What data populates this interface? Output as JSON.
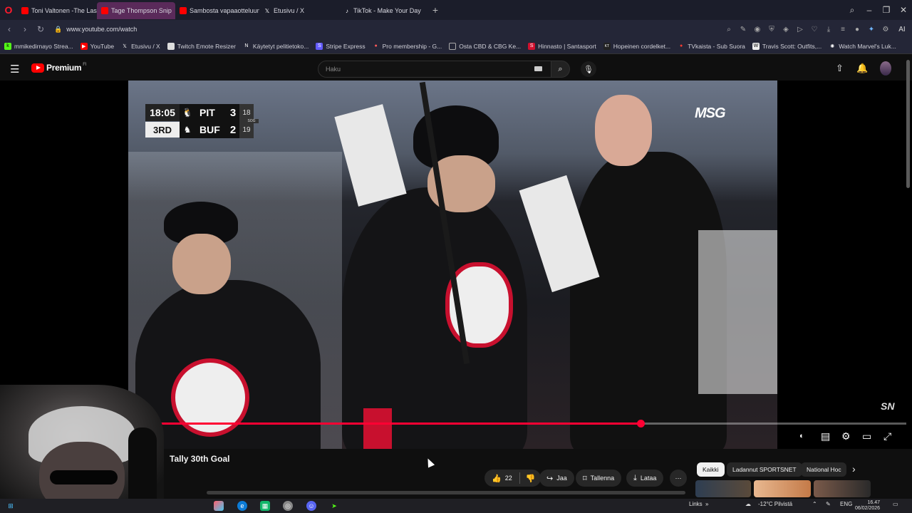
{
  "browser": {
    "tabs": [
      {
        "label": "Toni Valtonen -The Last D",
        "state": "normal"
      },
      {
        "label": "Tage Thompson Snip",
        "state": "active"
      },
      {
        "label": "Sambosta vapaaotteluun",
        "state": "normal"
      },
      {
        "label": "Etusivu / X",
        "state": "normal"
      },
      {
        "label": "TikTok - Make Your Day",
        "state": "normal"
      }
    ],
    "url": "www.youtube.com/watch",
    "ai_label": "AI",
    "bookmarks": [
      "mmikedirnayo Strea...",
      "YouTube",
      "Etusivu / X",
      "Twitch Emote Resizer",
      "Käytetyt pelitietoko...",
      "Stripe Express",
      "Pro membership - G...",
      "Osta CBD & CBG Ke...",
      "Hinnasto | Santasport",
      "Hopeinen cordelket...",
      "TVkaista - Sub Suora",
      "Travis Scott: Outfits,...",
      "Watch Marvel's Luk..."
    ]
  },
  "youtube": {
    "logo_text": "Premium",
    "logo_region": "FI",
    "search_placeholder": "Haku"
  },
  "video": {
    "scorebug": {
      "clock": "18:05",
      "period": "3RD",
      "away": {
        "team": "PIT",
        "score": "3",
        "sog": "18"
      },
      "home": {
        "team": "BUF",
        "score": "2",
        "sog": "19"
      },
      "sog_label": "SOG"
    },
    "network_logo": "MSG",
    "corner_logo": "SN",
    "progress": 0.705,
    "title": "Tally 30th Goal"
  },
  "actions": {
    "likes": "22",
    "share": "Jaa",
    "save": "Tallenna",
    "download": "Lataa"
  },
  "chips": [
    "Kaikki",
    "Ladannut SPORTSNET",
    "National Hoc"
  ],
  "taskbar": {
    "links_label": "Links",
    "weather": "-12°C Pilvistä",
    "lang": "ENG",
    "time": "16.47",
    "date": "06/02/2026"
  },
  "colors": {
    "accent": "#ff0033",
    "sabres_red": "#c8102e",
    "background": "#0f0f0f"
  }
}
